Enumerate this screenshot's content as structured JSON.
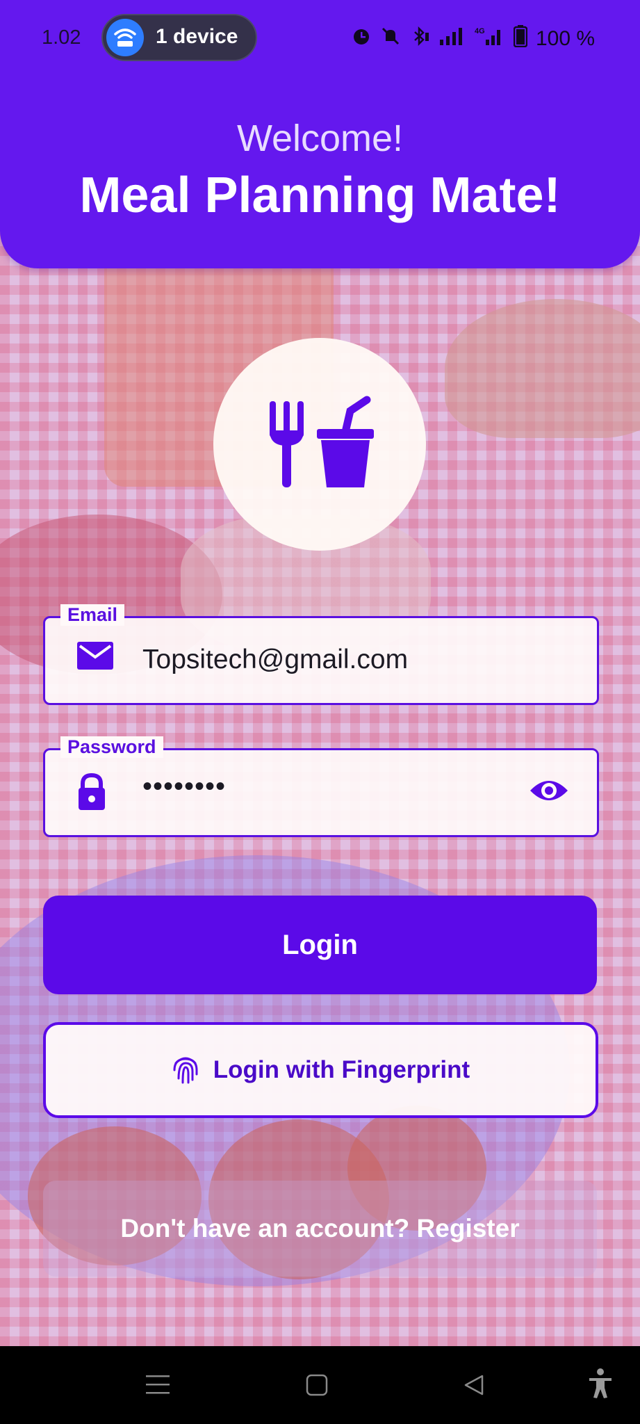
{
  "status_bar": {
    "time": "1.02",
    "device_pill": "1 device",
    "battery": "100 %",
    "icons": [
      "alarm-icon",
      "silent-bell-icon",
      "bluetooth-icon",
      "signal-icon",
      "4g-signal-icon",
      "battery-icon"
    ]
  },
  "header": {
    "welcome": "Welcome!",
    "title": "Meal Planning Mate!"
  },
  "logo": {
    "icons": [
      "fork-icon",
      "drink-cup-icon"
    ]
  },
  "email": {
    "label": "Email",
    "value": "Topsitech@gmail.com",
    "icon": "mail-icon"
  },
  "password": {
    "label": "Password",
    "value": "••••••••",
    "icon": "lock-icon",
    "toggle_icon": "eye-icon"
  },
  "buttons": {
    "login": "Login",
    "fingerprint": "Login with Fingerprint"
  },
  "register": {
    "text": "Don't have an account? Register"
  },
  "nav_bar": {
    "items": [
      "menu-icon",
      "home-square-icon",
      "back-triangle-icon",
      "accessibility-icon"
    ]
  },
  "colors": {
    "primary": "#5b0ae8",
    "header": "#6418ee",
    "text_dark": "#1c1a24"
  }
}
